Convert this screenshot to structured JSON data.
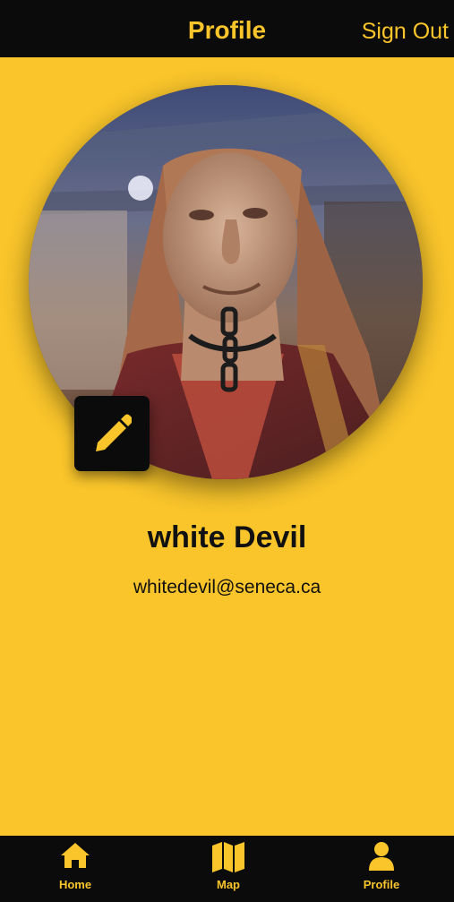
{
  "header": {
    "title": "Profile",
    "sign_out_label": "Sign Out"
  },
  "profile": {
    "name": "white Devil",
    "email": "whitedevil@seneca.ca",
    "edit_icon": "pencil-icon"
  },
  "tabs": [
    {
      "label": "Home",
      "icon": "home-icon"
    },
    {
      "label": "Map",
      "icon": "map-icon"
    },
    {
      "label": "Profile",
      "icon": "person-icon"
    }
  ],
  "colors": {
    "accent": "#f9c52b",
    "bar": "#0b0b0b",
    "text": "#111111"
  }
}
